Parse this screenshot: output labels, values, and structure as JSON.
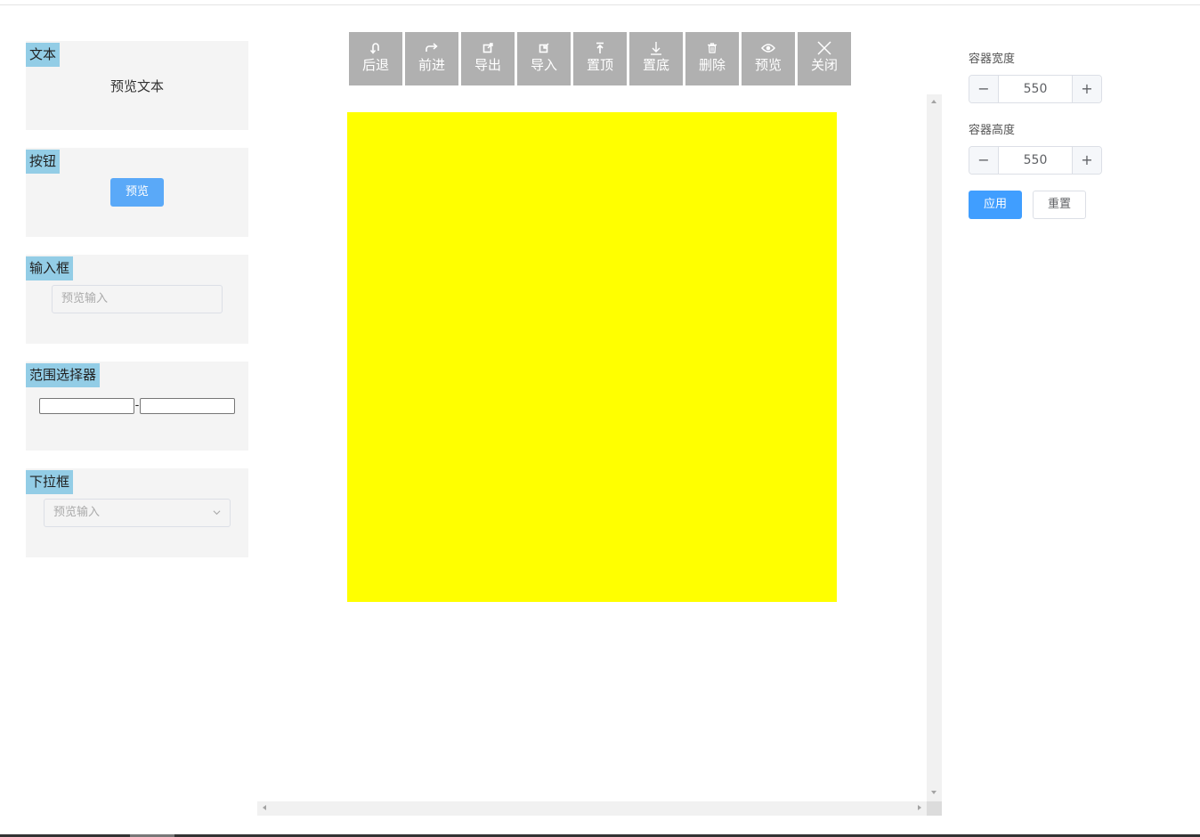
{
  "palette": {
    "text": {
      "tag": "文本",
      "preview": "预览文本"
    },
    "button": {
      "tag": "按钮",
      "preview": "预览"
    },
    "input": {
      "tag": "输入框",
      "placeholder": "预览输入"
    },
    "range": {
      "tag": "范围选择器",
      "separator": "-"
    },
    "select": {
      "tag": "下拉框",
      "placeholder": "预览输入"
    }
  },
  "toolbar": {
    "items": [
      {
        "label": "后退",
        "icon": "undo-icon"
      },
      {
        "label": "前进",
        "icon": "redo-icon"
      },
      {
        "label": "导出",
        "icon": "export-icon"
      },
      {
        "label": "导入",
        "icon": "import-icon"
      },
      {
        "label": "置顶",
        "icon": "bring-to-top-icon"
      },
      {
        "label": "置底",
        "icon": "send-to-bottom-icon"
      },
      {
        "label": "删除",
        "icon": "trash-icon"
      },
      {
        "label": "预览",
        "icon": "eye-icon"
      },
      {
        "label": "关闭",
        "icon": "close-icon"
      }
    ]
  },
  "canvas": {
    "block_color": "#ffff00"
  },
  "settings": {
    "width_label": "容器宽度",
    "width_value": "550",
    "height_label": "容器高度",
    "height_value": "550",
    "minus": "−",
    "plus": "+",
    "apply_label": "应用",
    "reset_label": "重置"
  },
  "colors": {
    "accent": "#409eff",
    "tag_bg": "#93cde6",
    "toolbar_bg": "#b0b0b0"
  }
}
